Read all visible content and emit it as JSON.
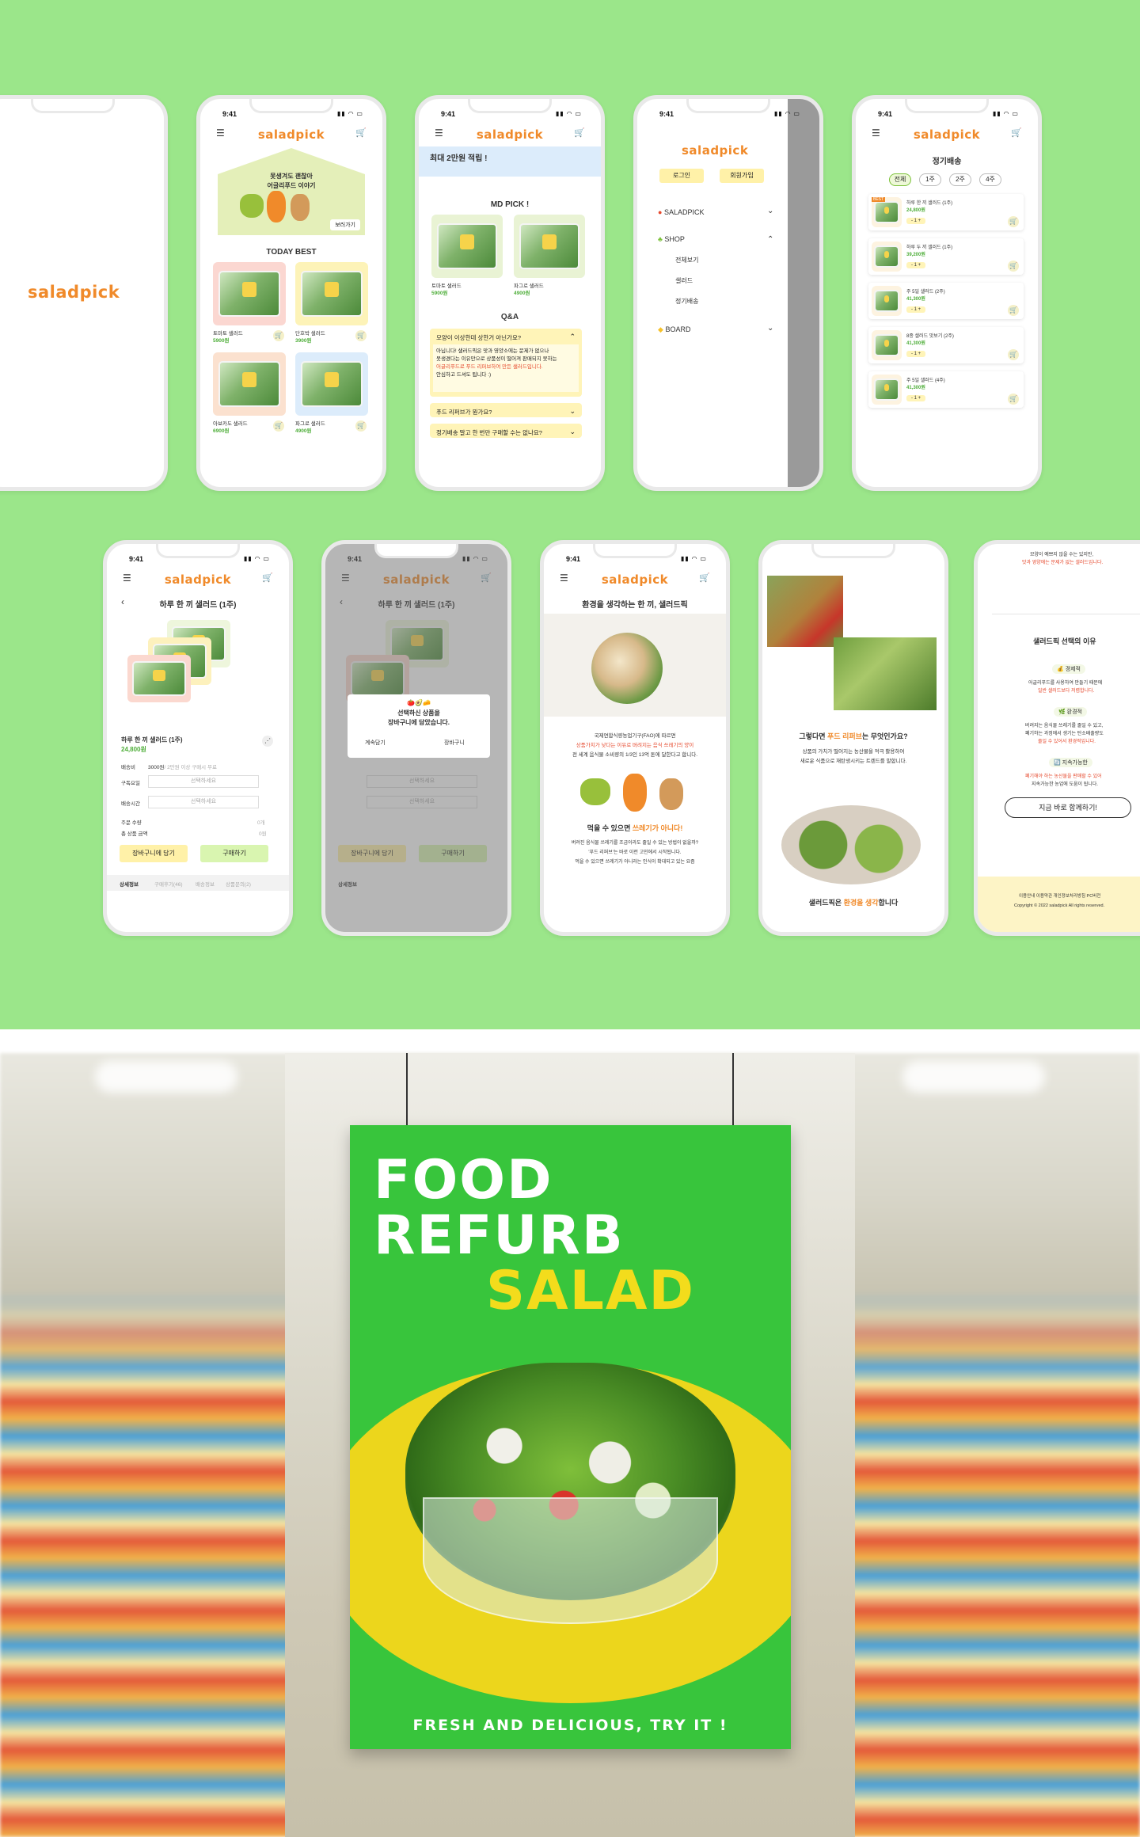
{
  "brand": {
    "logo": "saladpick",
    "orange": "#f08a2a",
    "green": "#7cc23a",
    "bg_green": "#9be68a"
  },
  "status": {
    "time": "9:41"
  },
  "s2": {
    "hero_line1": "못생겨도 괜찮아",
    "hero_line2": "어글리푸드 이야기",
    "hero_btn": "보러가기",
    "section": "TODAY BEST",
    "products": [
      {
        "name": "토마토 샐러드",
        "price": "5900원"
      },
      {
        "name": "단호박 샐러드",
        "price": "3900원"
      },
      {
        "name": "아보카도 샐러드",
        "price": "6900원"
      },
      {
        "name": "파그로 샐러드",
        "price": "4900원"
      }
    ]
  },
  "s3": {
    "banner": "최대 2만원 적립 !",
    "md_title": "MD PICK !",
    "md_items": [
      {
        "name": "토마토 샐러드",
        "price": "5900원"
      },
      {
        "name": "파그로 샐러드",
        "price": "4900원"
      }
    ],
    "qa_title": "Q&A",
    "qa": [
      "모양이 이상한데 상한거 아닌가요?",
      "푸드 리퍼브가 뭔가요?",
      "정기배송 말고 한 번만 구매할 수는 없나요?"
    ],
    "qa_answer_1": "아닙니다! 샐러드픽은 맛과 영양소에는 문제가 없으나",
    "qa_answer_2": "못생겼다는 이유만으로 상품성이 떨어져 판매되지 못하는",
    "qa_answer_3": "어글리푸드로 푸드 리퍼브하여 만든 샐러드입니다.",
    "qa_answer_4": "안심하고 드셔도 됩니다 :)"
  },
  "s4": {
    "login": "로그인",
    "join": "회원가입",
    "menu_saladpick": "SALADPICK",
    "menu_shop": "SHOP",
    "sub_all": "전체보기",
    "sub_salad": "샐러드",
    "sub_regular": "정기배송",
    "menu_board": "BOARD"
  },
  "s5": {
    "title": "정기배송",
    "tabs": [
      "전체",
      "1주",
      "2주",
      "4주"
    ],
    "items": [
      {
        "name": "하루 한 끼 샐러드 (1주)",
        "price": "24,800원",
        "badge": "BEST"
      },
      {
        "name": "하루 두 끼 샐러드 (1주)",
        "price": "39,200원",
        "badge": ""
      },
      {
        "name": "주 5일 샐러드 (2주)",
        "price": "41,300원",
        "badge": ""
      },
      {
        "name": "8종 샐러드 맛보기 (2주)",
        "price": "41,300원",
        "badge": ""
      },
      {
        "name": "주 5일 샐러드 (4주)",
        "price": "41,300원",
        "badge": ""
      }
    ],
    "qty": "1"
  },
  "s6": {
    "title": "하루 한 끼 샐러드 (1주)",
    "name": "하루 한 끼 샐러드 (1주)",
    "price": "24,800원",
    "ship_label": "배송비",
    "ship_value": "3000원",
    "ship_note": "/ 2만원 이상 구매시 무료",
    "day_label": "구독요일",
    "day_placeholder": "선택하세요",
    "time_label": "배송시간",
    "time_placeholder": "선택하세요",
    "order_qty": "주문 수량",
    "order_qty_val": "0개",
    "total": "총 상품 금액",
    "total_val": "0원",
    "add_cart": "장바구니에 담기",
    "buy": "구매하기",
    "tabs": [
      "상세정보",
      "구매후기(46)",
      "배송정보",
      "상품문의(2)"
    ]
  },
  "s7": {
    "modal_line1": "선택하신 상품을",
    "modal_line2": "장바구니에 담았습니다.",
    "continue": "계속담기",
    "go_cart": "장바구니"
  },
  "s8": {
    "title": "환경을 생각하는 한 끼, 샐러드픽",
    "p1": "국제연합식량농업기구(FAO)에 따르면",
    "p2": "상품가치가 낮다는 이유로 버려지는 음식 쓰레기의 양이",
    "p3": "전 세계 음식물 소비량의 1/3인 13억 톤에 달한다고 합니다.",
    "headline_a": "먹을 수 있으면 ",
    "headline_b": "쓰레기가 아니다!",
    "q1": "버려진 음식물 쓰레기를 조금이라도 줄일 수 있는 방법이 없을까?",
    "q2": "'푸드 리퍼브'는 바로 이런 고민에서 시작됩니다.",
    "q3": "먹을 수 있으면 쓰레기가 아니라는 인식이 확대되고 있는 요즘"
  },
  "s9": {
    "question_a": "그렇다면 ",
    "question_b": "푸드 리퍼브",
    "question_c": "는 무엇인가요?",
    "p1": "상품의 가치가 떨어지는 농산물을 적극 활용하여",
    "p2": "새로운 식품으로 재탄생시키는 트렌드를 말합니다.",
    "closing_a": "샐러드픽은 ",
    "closing_b": "환경을 생각",
    "closing_c": "합니다"
  },
  "s10": {
    "top1": "모양이 예쁘지 않을 수는 있지만,",
    "top2": "맛과 영양에는 문제가 없는 샐러드입니다.",
    "title": "샐러드픽 선택의 이유",
    "r1": "경제적",
    "r1_t1": "어글리푸드를 사용하여 만들기 때문에",
    "r1_t2": "일반 샐러드보다 저렴합니다.",
    "r2": "환경적",
    "r2_t1": "버려지는 음식물 쓰레기를 줄일 수 있고,",
    "r2_t2": "폐기하는 과정에서 생기는 탄소배출량도",
    "r2_t3": "줄일 수 있어서 환경적입니다.",
    "r3": "지속가능한",
    "r3_t1": "폐기해야 하는 농산물을 판매할 수 있어",
    "r3_t2": "지속가능한 농업에 도움이 됩니다.",
    "cta": "지금 바로 함께하기!",
    "footer_links": "이용안내   이용약관   개인정보처리방침   PC버전",
    "copyright": "Copyright © 2022 saladpick All rights reserved."
  },
  "poster": {
    "line1": "FOOD",
    "line2": "REFURB",
    "line3": "SALAD",
    "tagline": "FRESH AND DELICIOUS, TRY IT !",
    "bg": "#38c53c",
    "accent": "#ecd61c"
  }
}
